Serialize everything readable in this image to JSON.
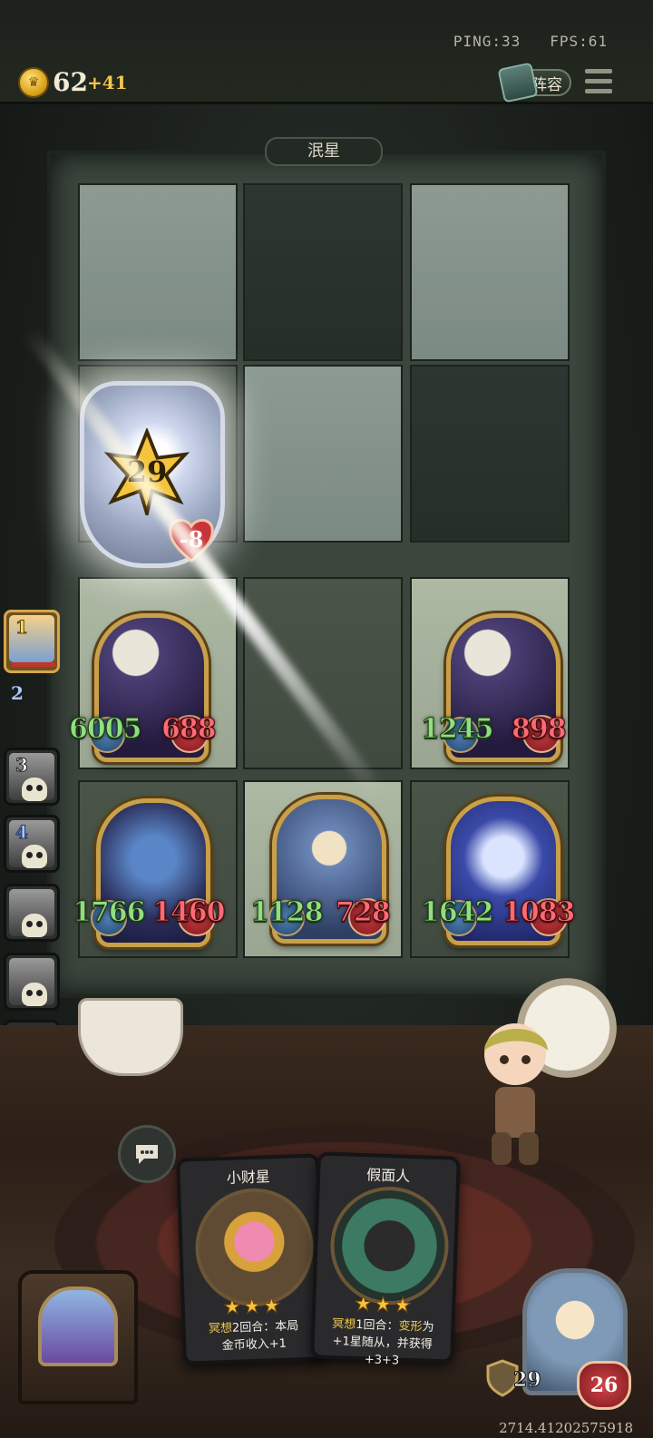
{
  "status": {
    "ping_label": "PING:33",
    "fps_label": "FPS:61"
  },
  "resources": {
    "gold": "62",
    "income": "+41"
  },
  "top_buttons": {
    "lineup_label": "阵容",
    "menu_icon": "hamburger-menu-icon"
  },
  "board": {
    "title": "泯星",
    "relic": {
      "star_value": "29",
      "damage": "-8"
    },
    "units": [
      {
        "id": "u1",
        "attack": "6005",
        "health": "688",
        "art": "moon-mage"
      },
      {
        "id": "u2",
        "attack": "1245",
        "health": "898",
        "art": "moon-mage"
      },
      {
        "id": "u3",
        "attack": "1766",
        "health": "1460",
        "art": "blue-hair-mage"
      },
      {
        "id": "u4",
        "attack": "1128",
        "health": "728",
        "art": "dwarf-king"
      },
      {
        "id": "u5",
        "attack": "1642",
        "health": "1083",
        "art": "blue-hair-girl"
      }
    ]
  },
  "roster": [
    {
      "rank": "1",
      "style": "gold",
      "active": true
    },
    {
      "rank": "2",
      "style": "blue"
    },
    {
      "rank": "3",
      "style": "white",
      "eliminated": true
    },
    {
      "rank": "4",
      "style": "blue",
      "eliminated": true
    },
    {
      "rank": "",
      "eliminated": true
    },
    {
      "rank": "",
      "eliminated": true
    },
    {
      "rank": "",
      "eliminated": true
    },
    {
      "rank": "",
      "eliminated": true
    }
  ],
  "hand": [
    {
      "name": "小财星",
      "stars": "★★★",
      "keyword": "冥想",
      "desc_line1_rest": "2回合：本局",
      "desc_line2": "金币收入+1"
    },
    {
      "name": "假面人",
      "stars": "★★★",
      "keyword": "冥想",
      "desc_line1_mid": "1回合：",
      "desc_line1_kw": "变形",
      "desc_line1_end": "为",
      "desc_line2": "+1星随从，并获得+3+3"
    }
  ],
  "hero": {
    "armor": "29",
    "health": "26"
  },
  "footer": {
    "seed": "2714.41202575918"
  },
  "colors": {
    "attack": "#8fe07a",
    "health": "#ff6a72",
    "gold": "#f2c94c"
  }
}
